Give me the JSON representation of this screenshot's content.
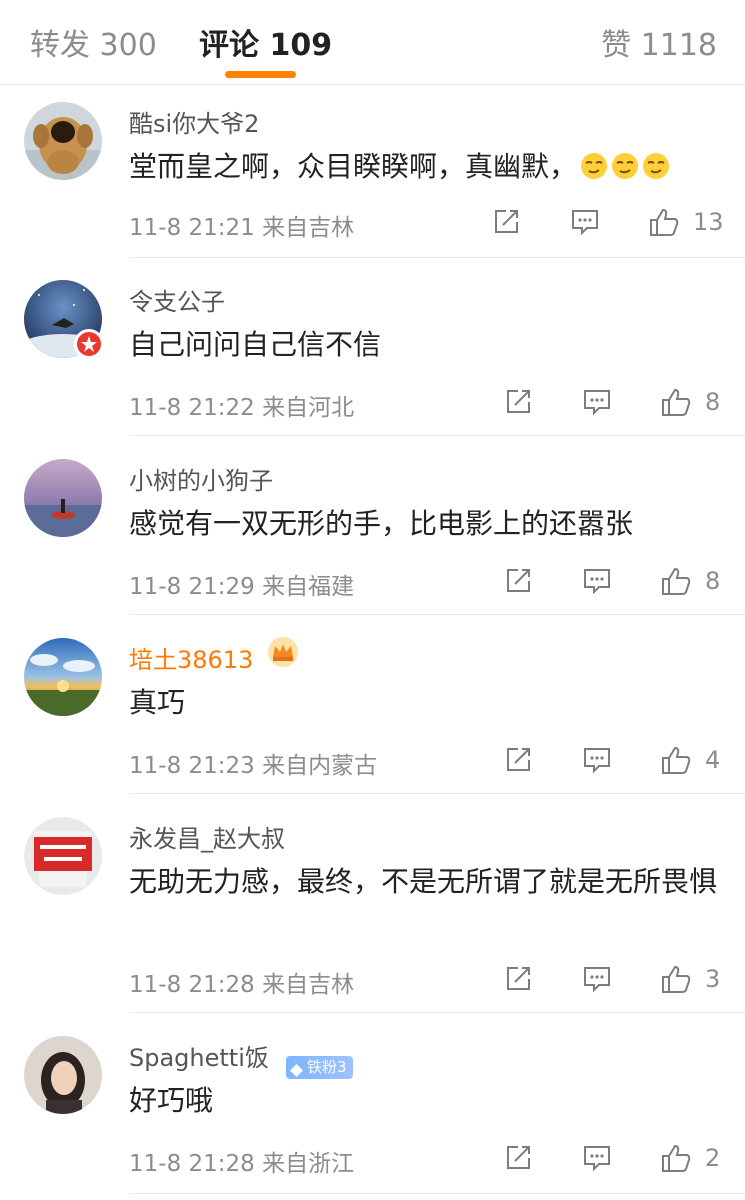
{
  "tabs": {
    "repost_label": "转发 300",
    "comments_label": "评论 109",
    "likes_label": "赞 1118"
  },
  "colors": {
    "accent": "#ff8200",
    "vip_name": "#ff7a00",
    "fan_badge": "#8fbcff"
  },
  "comments": [
    {
      "user": "酷si你大爷2",
      "text": "堂而皇之啊，众目睽睽啊，真幽默，",
      "time_location": "11-8 21:21 来自吉林",
      "likes": "13",
      "emoji": "smirk-emoji"
    },
    {
      "user": "令支公子",
      "text": "自己问问自己信不信",
      "time_location": "11-8 21:22 来自河北",
      "likes": "8"
    },
    {
      "user": "小树的小狗子",
      "text": "感觉有一双无形的手，比电影上的还嚣张",
      "time_location": "11-8 21:29 来自福建",
      "likes": "8"
    },
    {
      "user": "培土38613",
      "text": "真巧",
      "time_location": "11-8 21:23 来自内蒙古",
      "likes": "4",
      "badge": "crown-icon"
    },
    {
      "user": "永发昌_赵大叔",
      "text": "无助无力感，最终，不是无所谓了就是无所畏惧",
      "time_location": "11-8 21:28 来自吉林",
      "likes": "3"
    },
    {
      "user": "Spaghetti饭",
      "text": "好巧哦",
      "time_location": "11-8 21:28 来自浙江",
      "likes": "2",
      "fan_badge": "铁粉3"
    }
  ],
  "icons": [
    "repost-icon",
    "comment-icon",
    "like-icon"
  ]
}
